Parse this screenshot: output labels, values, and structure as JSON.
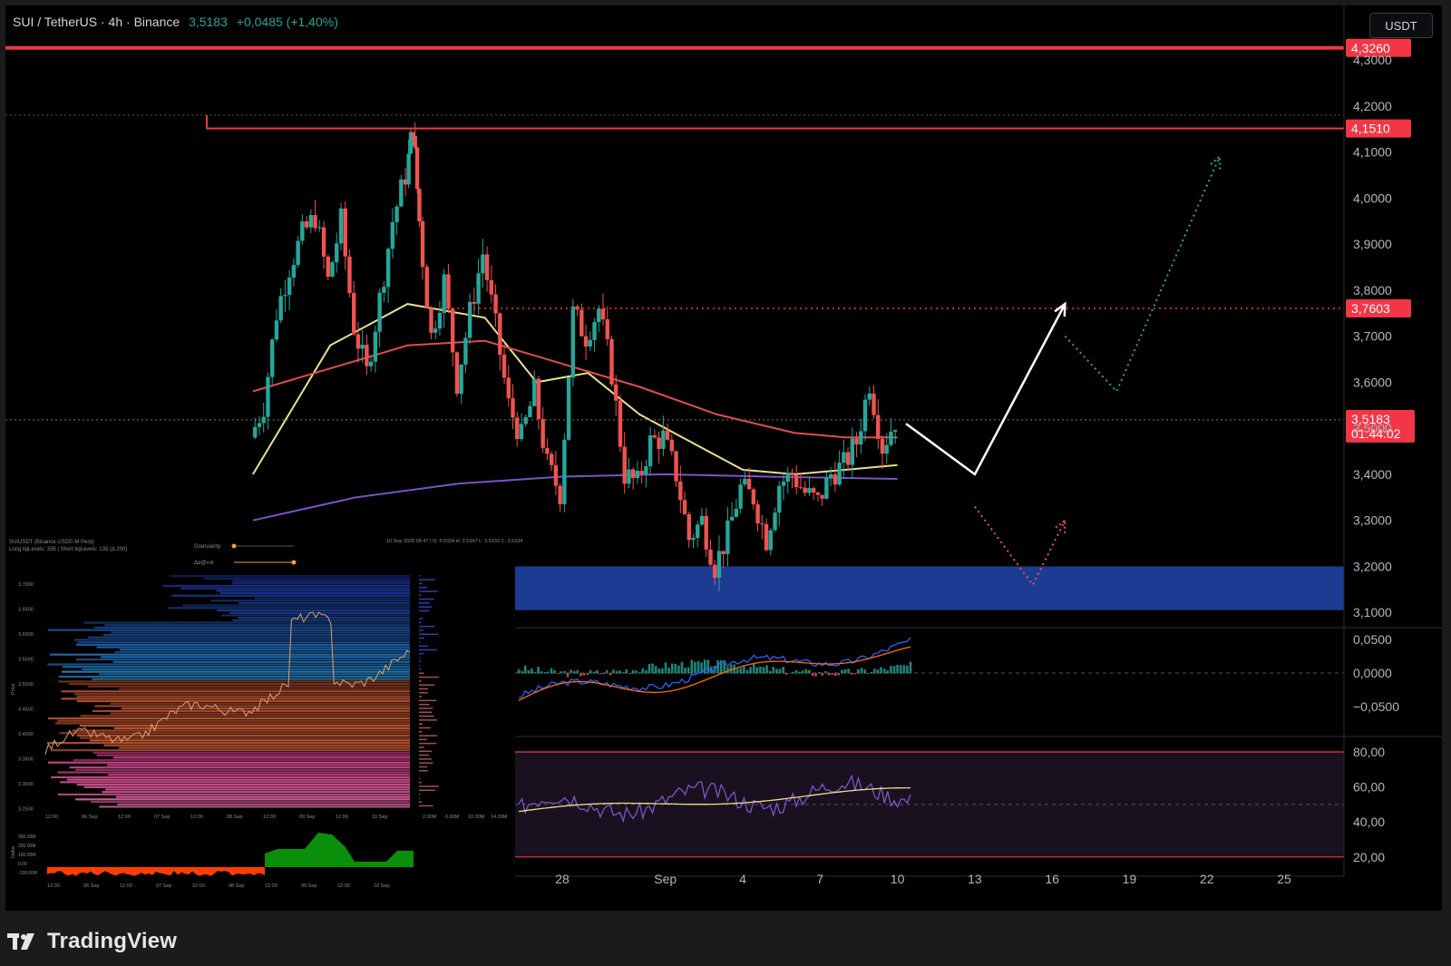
{
  "header": {
    "symbol": "SUI / TetherUS · 4h · Binance",
    "last": "3,5183",
    "change": "+0,0485 (+1,40%)"
  },
  "currency_button": "USDT",
  "footer": {
    "brand": "TradingView",
    "logo_icon": "tradingview-logo-icon"
  },
  "colors": {
    "up": "#26a69a",
    "down": "#ef5350",
    "resistance": "#f23645",
    "zone": "#1c3f9a",
    "ema_fast": "#e8e08a",
    "ema_mid": "#e04d4d",
    "ema_slow": "#7d52c9"
  },
  "chart_data": [
    {
      "type": "line",
      "name": "price",
      "y_axis": {
        "ticks": [
          "4,3000",
          "4,2000",
          "4,1000",
          "4,0000",
          "3,9000",
          "3,8000",
          "3,7000",
          "3,6000",
          "3,5000",
          "3,4000",
          "3,3000",
          "3,2000",
          "3,1000"
        ],
        "values": [
          4.3,
          4.2,
          4.1,
          4.0,
          3.9,
          3.8,
          3.7,
          3.6,
          3.5,
          3.4,
          3.3,
          3.2,
          3.1
        ]
      },
      "x_axis": {
        "ticks": [
          "28",
          "Sep",
          "4",
          "7",
          "10",
          "13",
          "16",
          "19",
          "22",
          "25"
        ],
        "dates": [
          "2025-08-28",
          "2025-09-01",
          "2025-09-04",
          "2025-09-07",
          "2025-09-10",
          "2025-09-13",
          "2025-09-16",
          "2025-09-19",
          "2025-09-22",
          "2025-09-25"
        ]
      },
      "candles_close_path": [
        [
          "2025-08-16",
          3.48
        ],
        [
          "2025-08-16T12:00",
          3.55
        ],
        [
          "2025-08-17",
          3.75
        ],
        [
          "2025-08-17T12:00",
          3.85
        ],
        [
          "2025-08-18",
          3.92
        ],
        [
          "2025-08-18T12:00",
          3.96
        ],
        [
          "2025-08-19",
          3.82
        ],
        [
          "2025-08-19T12:00",
          3.95
        ],
        [
          "2025-08-20",
          3.72
        ],
        [
          "2025-08-20T12:00",
          3.62
        ],
        [
          "2025-08-21",
          3.78
        ],
        [
          "2025-08-21T12:00",
          3.95
        ],
        [
          "2025-08-22",
          4.05
        ],
        [
          "2025-08-22T06:00",
          4.16
        ],
        [
          "2025-08-22T12:00",
          3.95
        ],
        [
          "2025-08-23",
          3.7
        ],
        [
          "2025-08-23T12:00",
          3.82
        ],
        [
          "2025-08-24",
          3.6
        ],
        [
          "2025-08-24T12:00",
          3.75
        ],
        [
          "2025-08-25",
          3.88
        ],
        [
          "2025-08-25T12:00",
          3.72
        ],
        [
          "2025-08-26",
          3.55
        ],
        [
          "2025-08-26T12:00",
          3.48
        ],
        [
          "2025-08-27",
          3.58
        ],
        [
          "2025-08-27T12:00",
          3.42
        ],
        [
          "2025-08-28",
          3.36
        ],
        [
          "2025-08-28T12:00",
          3.75
        ],
        [
          "2025-08-29",
          3.7
        ],
        [
          "2025-08-29T12:00",
          3.76
        ],
        [
          "2025-08-30",
          3.62
        ],
        [
          "2025-08-30T12:00",
          3.4
        ],
        [
          "2025-08-31",
          3.38
        ],
        [
          "2025-08-31T12:00",
          3.47
        ],
        [
          "2025-09-01",
          3.48
        ],
        [
          "2025-09-01T12:00",
          3.4
        ],
        [
          "2025-09-02",
          3.26
        ],
        [
          "2025-09-02T12:00",
          3.3
        ],
        [
          "2025-09-03",
          3.2
        ],
        [
          "2025-09-03T12:00",
          3.27
        ],
        [
          "2025-09-04",
          3.37
        ],
        [
          "2025-09-04T12:00",
          3.35
        ],
        [
          "2025-09-05",
          3.26
        ],
        [
          "2025-09-05T12:00",
          3.38
        ],
        [
          "2025-09-06",
          3.4
        ],
        [
          "2025-09-06T12:00",
          3.36
        ],
        [
          "2025-09-07",
          3.34
        ],
        [
          "2025-09-07T12:00",
          3.4
        ],
        [
          "2025-09-08",
          3.42
        ],
        [
          "2025-09-08T12:00",
          3.47
        ],
        [
          "2025-09-09",
          3.6
        ],
        [
          "2025-09-09T12:00",
          3.46
        ],
        [
          "2025-09-10",
          3.5183
        ]
      ],
      "moving_averages": [
        {
          "color": "#e8e08a",
          "points": [
            [
              "2025-08-16",
              3.4
            ],
            [
              "2025-08-19",
              3.68
            ],
            [
              "2025-08-22",
              3.77
            ],
            [
              "2025-08-25",
              3.74
            ],
            [
              "2025-08-27",
              3.6
            ],
            [
              "2025-08-29",
              3.62
            ],
            [
              "2025-08-31",
              3.53
            ],
            [
              "2025-09-02",
              3.47
            ],
            [
              "2025-09-04",
              3.41
            ],
            [
              "2025-09-06",
              3.4
            ],
            [
              "2025-09-08",
              3.41
            ],
            [
              "2025-09-10",
              3.42
            ]
          ]
        },
        {
          "color": "#e04d4d",
          "points": [
            [
              "2025-08-16",
              3.58
            ],
            [
              "2025-08-19",
              3.63
            ],
            [
              "2025-08-22",
              3.68
            ],
            [
              "2025-08-25",
              3.69
            ],
            [
              "2025-08-28",
              3.64
            ],
            [
              "2025-08-31",
              3.59
            ],
            [
              "2025-09-03",
              3.53
            ],
            [
              "2025-09-06",
              3.49
            ],
            [
              "2025-09-08",
              3.48
            ],
            [
              "2025-09-10",
              3.48
            ]
          ]
        },
        {
          "color": "#7d52c9",
          "points": [
            [
              "2025-08-16",
              3.3
            ],
            [
              "2025-08-20",
              3.35
            ],
            [
              "2025-08-24",
              3.38
            ],
            [
              "2025-08-28",
              3.395
            ],
            [
              "2025-09-01",
              3.4
            ],
            [
              "2025-09-05",
              3.395
            ],
            [
              "2025-09-10",
              3.39
            ]
          ]
        }
      ],
      "horizontal_levels": [
        {
          "value": 4.326,
          "label": "4,3260",
          "style": "solid"
        },
        {
          "value": 4.151,
          "label": "4,1510",
          "style": "solid"
        },
        {
          "value": 3.7603,
          "label": "3,7603",
          "style": "dotted"
        }
      ],
      "last_price": {
        "value": 3.5183,
        "label": "3,5183",
        "countdown": "01:44:02"
      },
      "support_zone": {
        "from": 3.105,
        "to": 3.2
      },
      "projections": [
        {
          "style": "solid",
          "color": "#ffffff",
          "points": [
            [
              "2025-09-10T08:00",
              3.51
            ],
            [
              "2025-09-13",
              3.4
            ],
            [
              "2025-09-16T12:00",
              3.77
            ]
          ]
        },
        {
          "style": "dotted",
          "color": "#26a69a",
          "points": [
            [
              "2025-09-16T12:00",
              3.7
            ],
            [
              "2025-09-18T12:00",
              3.58
            ],
            [
              "2025-09-22T12:00",
              4.09
            ]
          ]
        },
        {
          "style": "dotted",
          "color": "#ef5350",
          "points": [
            [
              "2025-09-13",
              3.33
            ],
            [
              "2025-09-15T06:00",
              3.16
            ],
            [
              "2025-09-16T12:00",
              3.3
            ]
          ]
        }
      ]
    },
    {
      "type": "line",
      "name": "macd",
      "y_axis": {
        "ticks": [
          "0,0500",
          "0,0000",
          "−0,0500"
        ],
        "values": [
          0.05,
          0.0,
          -0.05
        ]
      }
    },
    {
      "type": "line",
      "name": "rsi",
      "y_axis": {
        "ticks": [
          "80,00",
          "60,00",
          "40,00",
          "20,00"
        ],
        "values": [
          80,
          60,
          40,
          20
        ]
      },
      "bands": [
        20,
        80
      ]
    }
  ],
  "inset": {
    "title": "SUIUSDT (Binance USD©-M Perp)",
    "subtitle": "Long liqLevels: 335 | Short liqLevels: 135 (Δ 200)",
    "controls": [
      "Granularity",
      "Δα@vol"
    ],
    "ohlc": "10 Sep 2025 08:47 | O: 3.5334 H: 3.5347 L: 3.5333 C: 3.5334",
    "y_ticks": [
      "3.7000",
      "3.6500",
      "3.6000",
      "3.5500",
      "3.5000",
      "3.4500",
      "3.4000",
      "3.3500",
      "3.3000",
      "3.2500"
    ],
    "x_ticks": [
      "12:00",
      "06 Sep",
      "12:00",
      "07 Sep",
      "12:00",
      "08 Sep",
      "12:00",
      "09 Sep",
      "12:00",
      "10 Sep"
    ],
    "vol_ticks": [
      "2.00M",
      "6.00M",
      "10.00M",
      "14.00M"
    ],
    "price_label": "Price",
    "delta_label": "Delta",
    "delta_ticks": [
      "300.00M",
      "200.00M",
      "100.00M",
      "0.00",
      "-100.00M"
    ]
  }
}
